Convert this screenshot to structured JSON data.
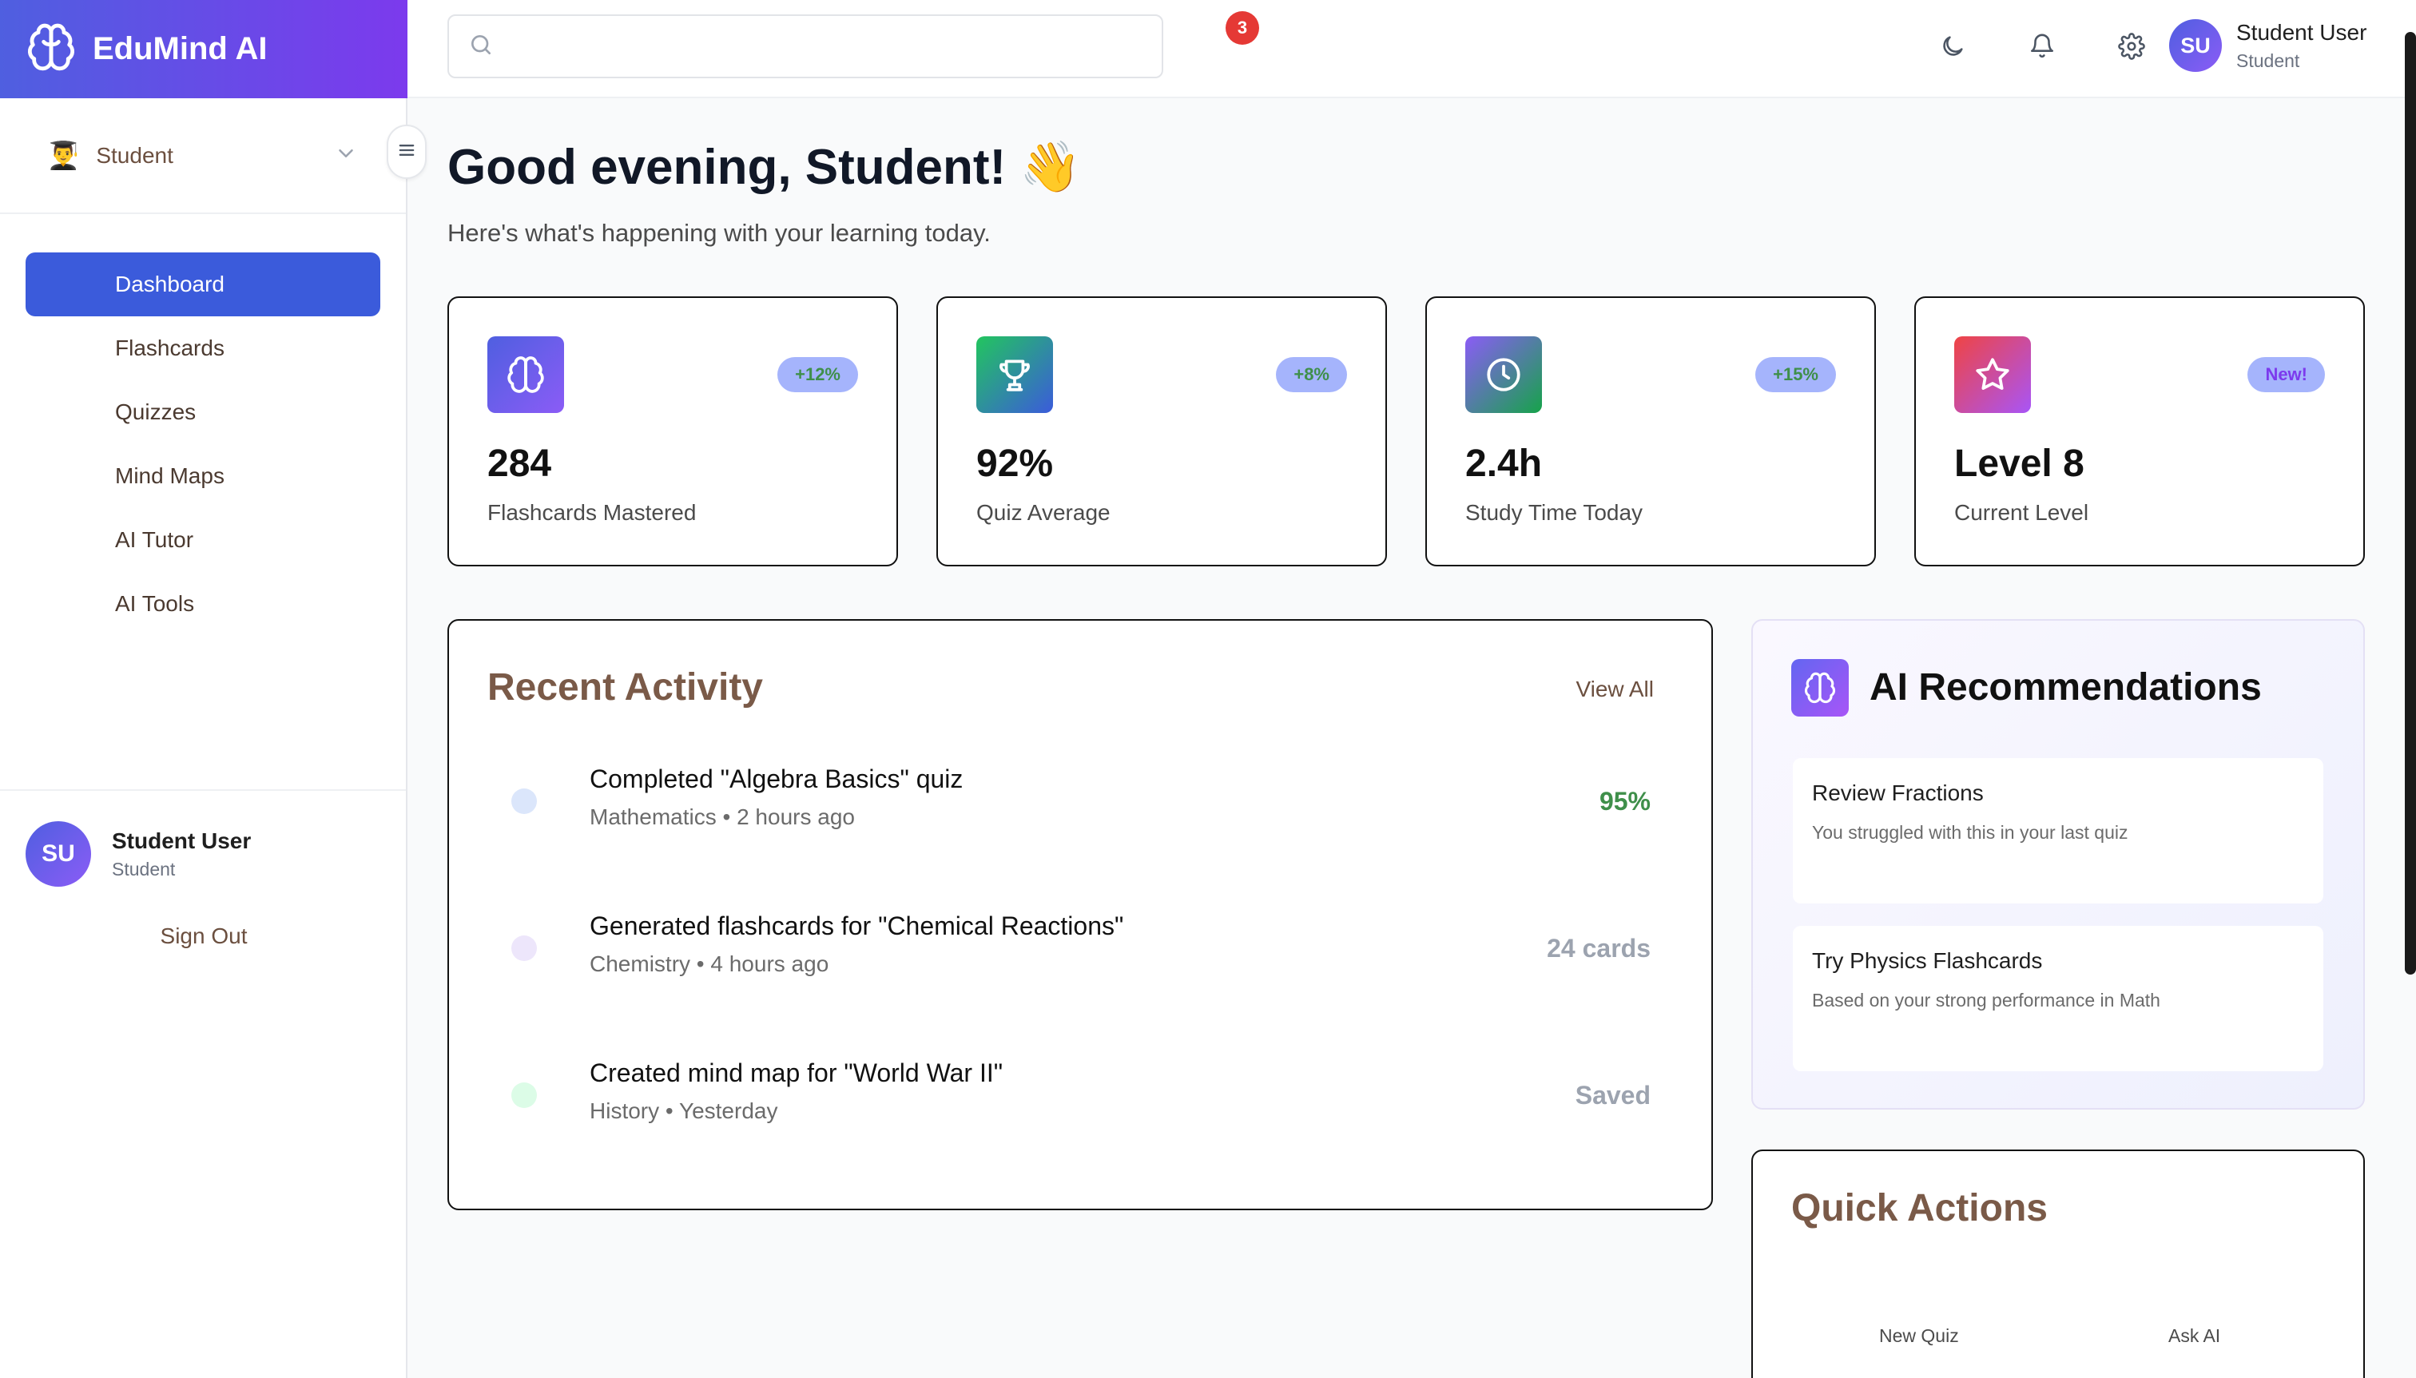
{
  "app": {
    "name": "EduMind AI"
  },
  "sidebar": {
    "role": {
      "emoji": "👨‍🎓",
      "label": "Student"
    },
    "nav": [
      {
        "label": "Dashboard",
        "active": true
      },
      {
        "label": "Flashcards"
      },
      {
        "label": "Quizzes"
      },
      {
        "label": "Mind Maps"
      },
      {
        "label": "AI Tutor"
      },
      {
        "label": "AI Tools"
      }
    ],
    "user": {
      "initials": "SU",
      "name": "Student User",
      "role": "Student"
    },
    "sign_out": "Sign Out"
  },
  "topbar": {
    "search": {
      "value": "",
      "placeholder": ""
    },
    "notifications": {
      "count": "3"
    },
    "user": {
      "initials": "SU",
      "name": "Student User",
      "role": "Student"
    }
  },
  "main": {
    "greeting": "Good evening, Student! 👋",
    "subgreeting": "Here's what's happening with your learning today.",
    "stats": [
      {
        "value": "284",
        "label": "Flashcards Mastered",
        "badge": "+12%",
        "icon": "brain-icon"
      },
      {
        "value": "92%",
        "label": "Quiz Average",
        "badge": "+8%",
        "icon": "trophy-icon"
      },
      {
        "value": "2.4h",
        "label": "Study Time Today",
        "badge": "+15%",
        "icon": "clock-icon"
      },
      {
        "value": "Level 8",
        "label": "Current Level",
        "badge": "New!",
        "icon": "star-icon"
      }
    ],
    "activity": {
      "title": "Recent Activity",
      "view_all": "View All",
      "items": [
        {
          "title": "Completed \"Algebra Basics\" quiz",
          "meta": "Mathematics • 2 hours ago",
          "result": "95%",
          "dot_color": "#dbe6fb",
          "result_color": "#3f8f4a"
        },
        {
          "title": "Generated flashcards for \"Chemical Reactions\"",
          "meta": "Chemistry • 4 hours ago",
          "result": "24 cards",
          "dot_color": "#ede6fb",
          "result_color": "#9ca3af"
        },
        {
          "title": "Created mind map for \"World War II\"",
          "meta": "History • Yesterday",
          "result": "Saved",
          "dot_color": "#dcfce7",
          "result_color": "#9ca3af"
        }
      ]
    },
    "recommendations": {
      "title": "AI Recommendations",
      "items": [
        {
          "title": "Review Fractions",
          "desc": "You struggled with this in your last quiz"
        },
        {
          "title": "Try Physics Flashcards",
          "desc": "Based on your strong performance in Math"
        }
      ]
    },
    "quick_actions": {
      "title": "Quick Actions",
      "buttons": [
        "New Quiz",
        "Ask AI"
      ]
    }
  },
  "colors": {
    "brand_start": "#4f5fe0",
    "brand_end": "#7c3aed",
    "active_nav": "#3b5bdb",
    "badge_red": "#e53935",
    "positive_green": "#3f8f4a"
  }
}
